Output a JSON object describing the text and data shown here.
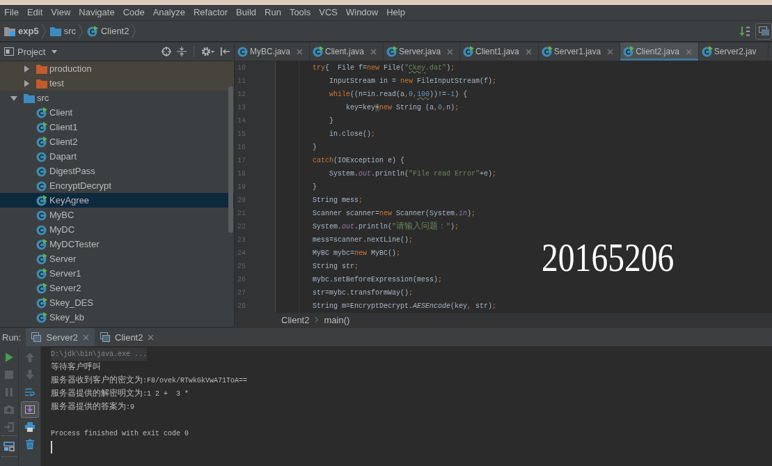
{
  "menu_bar": {
    "items": [
      "File",
      "Edit",
      "View",
      "Navigate",
      "Code",
      "Analyze",
      "Refactor",
      "Build",
      "Run",
      "Tools",
      "VCS",
      "Window",
      "Help"
    ]
  },
  "navigation_bar": {
    "crumbs": [
      {
        "label": "exp5",
        "kind": "project"
      },
      {
        "label": "src",
        "kind": "folder"
      },
      {
        "label": "Client2",
        "kind": "class",
        "runnable": true
      }
    ]
  },
  "project_panel": {
    "title": "Project",
    "tree": {
      "continued_items": [
        {
          "label": "production",
          "kind": "excluded-folder",
          "expanded": false,
          "selected": false
        },
        {
          "label": "test",
          "kind": "excluded-folder",
          "expanded": false,
          "selected": false
        }
      ],
      "items": [
        {
          "label": "src",
          "kind": "source-folder",
          "expanded": true,
          "selected": false,
          "children": [
            {
              "label": "Client",
              "kind": "class",
              "runnable": true,
              "selected": false
            },
            {
              "label": "Client1",
              "kind": "class",
              "runnable": true,
              "selected": false
            },
            {
              "label": "Client2",
              "kind": "class",
              "runnable": true,
              "selected": false
            },
            {
              "label": "Dapart",
              "kind": "class",
              "runnable": false,
              "selected": false
            },
            {
              "label": "DigestPass",
              "kind": "class",
              "runnable": false,
              "selected": false
            },
            {
              "label": "EncryptDecrypt",
              "kind": "class",
              "runnable": false,
              "selected": false
            },
            {
              "label": "KeyAgree",
              "kind": "class",
              "runnable": true,
              "selected": true
            },
            {
              "label": "MyBC",
              "kind": "class",
              "runnable": false,
              "selected": false
            },
            {
              "label": "MyDC",
              "kind": "class",
              "runnable": false,
              "selected": false
            },
            {
              "label": "MyDCTester",
              "kind": "class",
              "runnable": true,
              "selected": false
            },
            {
              "label": "Server",
              "kind": "class",
              "runnable": true,
              "selected": false
            },
            {
              "label": "Server1",
              "kind": "class",
              "runnable": true,
              "selected": false
            },
            {
              "label": "Server2",
              "kind": "class",
              "runnable": true,
              "selected": false
            },
            {
              "label": "Skey_DES",
              "kind": "class",
              "runnable": true,
              "selected": false
            },
            {
              "label": "Skey_kb",
              "kind": "class",
              "runnable": true,
              "selected": false
            }
          ]
        }
      ]
    }
  },
  "editor": {
    "tabs": [
      {
        "label": "MyBC.java",
        "runnable": false,
        "selected": false
      },
      {
        "label": "Client.java",
        "runnable": true,
        "selected": false
      },
      {
        "label": "Server.java",
        "runnable": true,
        "selected": false
      },
      {
        "label": "Client1.java",
        "runnable": true,
        "selected": false
      },
      {
        "label": "Server1.java",
        "runnable": true,
        "selected": false
      },
      {
        "label": "Client2.java",
        "runnable": true,
        "selected": true
      },
      {
        "label": "Server2.jav",
        "runnable": true,
        "selected": false
      }
    ],
    "lines": [
      {
        "number": "10",
        "tokens": [
          {
            "kind": "keyword",
            "text": "        try"
          },
          {
            "kind": "plain",
            "text": "{  File f="
          },
          {
            "kind": "keyword",
            "text": "new"
          },
          {
            "kind": "plain",
            "text": " File("
          },
          {
            "kind": "string",
            "text": "\""
          },
          {
            "kind": "string_flagged",
            "text": "Ckey"
          },
          {
            "kind": "string",
            "text": ".dat\""
          },
          {
            "kind": "plain",
            "text": ")"
          },
          {
            "kind": "punct",
            "text": ";"
          }
        ]
      },
      {
        "number": "11",
        "tokens": [
          {
            "kind": "plain",
            "text": "            InputStream in = "
          },
          {
            "kind": "keyword",
            "text": "new"
          },
          {
            "kind": "plain",
            "text": " FileInputStream(f)"
          },
          {
            "kind": "punct",
            "text": ";"
          }
        ]
      },
      {
        "number": "12",
        "tokens": [
          {
            "kind": "keyword",
            "text": "            while"
          },
          {
            "kind": "plain",
            "text": "((n=in.read(a"
          },
          {
            "kind": "punct",
            "text": ","
          },
          {
            "kind": "number",
            "text": "0"
          },
          {
            "kind": "punct",
            "text": ","
          },
          {
            "kind": "number_flagged",
            "text": "100"
          },
          {
            "kind": "plain",
            "text": "))!="
          },
          {
            "kind": "number",
            "text": "-1"
          },
          {
            "kind": "plain",
            "text": ") {"
          }
        ]
      },
      {
        "number": "13",
        "tokens": [
          {
            "kind": "plain",
            "text": "                key=key"
          },
          {
            "kind": "caret",
            "text": "+"
          },
          {
            "kind": "keyword",
            "text": "new"
          },
          {
            "kind": "plain",
            "text": " String (a"
          },
          {
            "kind": "punct",
            "text": ","
          },
          {
            "kind": "number",
            "text": "0"
          },
          {
            "kind": "punct",
            "text": ","
          },
          {
            "kind": "plain",
            "text": "n)"
          },
          {
            "kind": "punct",
            "text": ";"
          }
        ]
      },
      {
        "number": "14",
        "tokens": [
          {
            "kind": "plain",
            "text": "            }"
          }
        ]
      },
      {
        "number": "15",
        "tokens": [
          {
            "kind": "plain",
            "text": "            in.close()"
          },
          {
            "kind": "punct",
            "text": ";"
          }
        ]
      },
      {
        "number": "16",
        "tokens": [
          {
            "kind": "plain",
            "text": "        }"
          }
        ]
      },
      {
        "number": "17",
        "tokens": [
          {
            "kind": "keyword",
            "text": "        catch"
          },
          {
            "kind": "plain",
            "text": "(IOException e) {"
          }
        ]
      },
      {
        "number": "18",
        "tokens": [
          {
            "kind": "plain",
            "text": "            System."
          },
          {
            "kind": "field",
            "text": "out"
          },
          {
            "kind": "plain",
            "text": ".println("
          },
          {
            "kind": "string",
            "text": "\"File read Error\""
          },
          {
            "kind": "plain",
            "text": "+e)"
          },
          {
            "kind": "punct",
            "text": ";"
          }
        ]
      },
      {
        "number": "19",
        "tokens": [
          {
            "kind": "plain",
            "text": "        }"
          }
        ]
      },
      {
        "number": "20",
        "tokens": [
          {
            "kind": "plain",
            "text": "        String mess"
          },
          {
            "kind": "punct",
            "text": ";"
          }
        ]
      },
      {
        "number": "21",
        "tokens": [
          {
            "kind": "plain",
            "text": "        Scanner scanner="
          },
          {
            "kind": "keyword",
            "text": "new"
          },
          {
            "kind": "plain",
            "text": " Scanner(System."
          },
          {
            "kind": "field",
            "text": "in"
          },
          {
            "kind": "plain",
            "text": ")"
          },
          {
            "kind": "punct",
            "text": ";"
          }
        ]
      },
      {
        "number": "22",
        "tokens": [
          {
            "kind": "plain",
            "text": "        System."
          },
          {
            "kind": "field",
            "text": "out"
          },
          {
            "kind": "plain",
            "text": ".println("
          },
          {
            "kind": "string",
            "text": "\"请输入问题：\""
          },
          {
            "kind": "plain",
            "text": ")"
          },
          {
            "kind": "punct",
            "text": ";"
          }
        ]
      },
      {
        "number": "23",
        "tokens": [
          {
            "kind": "plain",
            "text": "        mess=scanner.nextLine()"
          },
          {
            "kind": "punct",
            "text": ";"
          }
        ]
      },
      {
        "number": "24",
        "tokens": [
          {
            "kind": "plain",
            "text": "        MyBC mybc="
          },
          {
            "kind": "keyword",
            "text": "new"
          },
          {
            "kind": "plain",
            "text": " MyBC()"
          },
          {
            "kind": "punct",
            "text": ";"
          }
        ]
      },
      {
        "number": "25",
        "tokens": [
          {
            "kind": "plain",
            "text": "        String str"
          },
          {
            "kind": "punct",
            "text": ";"
          }
        ]
      },
      {
        "number": "26",
        "tokens": [
          {
            "kind": "plain",
            "text": "        mybc.setBeforeExpression(mess)"
          },
          {
            "kind": "punct",
            "text": ";"
          }
        ]
      },
      {
        "number": "27",
        "tokens": [
          {
            "kind": "plain",
            "text": "        str=mybc.transformWay()"
          },
          {
            "kind": "punct",
            "text": ";"
          }
        ]
      },
      {
        "number": "28",
        "tokens": [
          {
            "kind": "plain",
            "text": "        String m=EncryptDecrypt."
          },
          {
            "kind": "static_call",
            "text": "AESEncode"
          },
          {
            "kind": "plain",
            "text": "(key"
          },
          {
            "kind": "punct",
            "text": ","
          },
          {
            "kind": "plain",
            "text": " str)"
          },
          {
            "kind": "punct",
            "text": ";"
          }
        ]
      }
    ],
    "breadcrumb": [
      "Client2",
      "main()"
    ],
    "overlay_text": "20165206"
  },
  "run_panel": {
    "title": "Run:",
    "tabs": [
      {
        "label": "Server2",
        "selected": true
      },
      {
        "label": "Client2",
        "selected": false
      }
    ],
    "execution_toolbar": [
      {
        "kind": "run",
        "disabled": false
      },
      {
        "kind": "stop",
        "disabled": true
      },
      {
        "kind": "pause",
        "disabled": true
      },
      {
        "kind": "snapshot",
        "disabled": true
      },
      {
        "kind": "exit",
        "disabled": true
      },
      {
        "kind": "layout",
        "disabled": false
      }
    ],
    "console_toolbar": [
      {
        "kind": "up",
        "disabled": true,
        "on": false
      },
      {
        "kind": "down",
        "disabled": true,
        "on": false
      },
      {
        "kind": "soft_wrap",
        "disabled": false,
        "on": false
      },
      {
        "kind": "scroll_to_end",
        "disabled": false,
        "on": true
      },
      {
        "kind": "print",
        "disabled": false,
        "on": false
      },
      {
        "kind": "clear",
        "disabled": false,
        "on": false
      }
    ],
    "console": {
      "lines": [
        {
          "kind": "command",
          "text": "D:\\jdk\\bin\\java.exe ..."
        },
        {
          "kind": "output",
          "text": "等待客户呼叫"
        },
        {
          "kind": "output",
          "text": "服务器收到客户的密文为:F8/ovek/RTwkGkVwA71ToA=="
        },
        {
          "kind": "output",
          "text": "服务器提供的解密明文为:1 2 +  3 *"
        },
        {
          "kind": "output",
          "text": "服务器提供的答案为:9"
        },
        {
          "kind": "exit",
          "text": "Process finished with exit code 0"
        }
      ],
      "caret": true
    }
  }
}
